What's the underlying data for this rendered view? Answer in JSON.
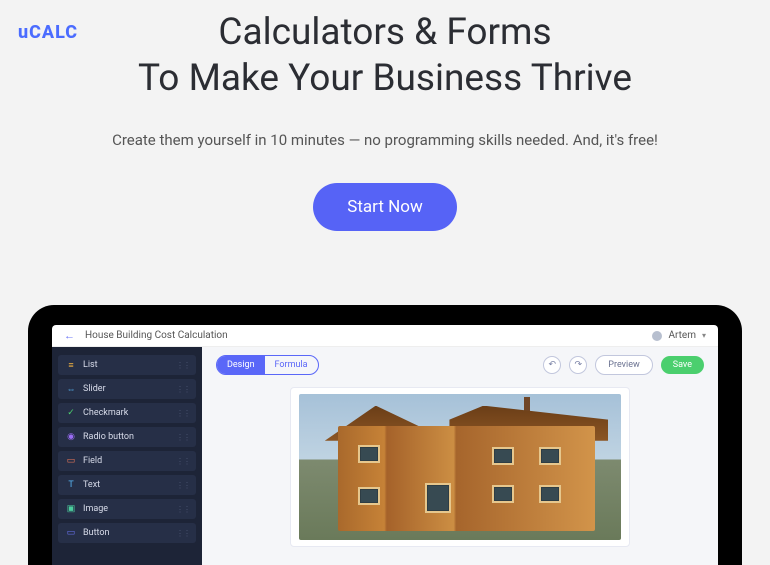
{
  "brand": "uCALC",
  "hero": {
    "title_line1": "Calculators & Forms",
    "title_line2": "To Make Your Business Thrive",
    "subtitle": "Create them yourself in 10 minutes — no programming skills needed. And, it's free!",
    "cta": "Start Now"
  },
  "app": {
    "back_arrow": "←",
    "project_title": "House Building Cost Calculation",
    "user_name": "Artem",
    "caret": "▾",
    "sidebar": [
      {
        "icon": "≡",
        "color": "#f4b441",
        "label": "List"
      },
      {
        "icon": "⇔",
        "color": "#58b6f4",
        "label": "Slider"
      },
      {
        "icon": "✓",
        "color": "#4bcf6e",
        "label": "Checkmark"
      },
      {
        "icon": "◉",
        "color": "#9a6cf4",
        "label": "Radio button"
      },
      {
        "icon": "▭",
        "color": "#f47a58",
        "label": "Field"
      },
      {
        "icon": "T",
        "color": "#58b6f4",
        "label": "Text"
      },
      {
        "icon": "▣",
        "color": "#4bcf9e",
        "label": "Image"
      },
      {
        "icon": "▭",
        "color": "#6a74f7",
        "label": "Button"
      }
    ],
    "toolbar": {
      "design": "Design",
      "formula": "Formula",
      "undo": "↶",
      "redo": "↷",
      "preview": "Preview",
      "save": "Save"
    }
  }
}
